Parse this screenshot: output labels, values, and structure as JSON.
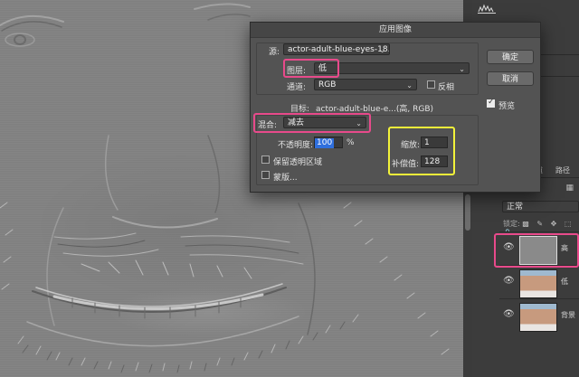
{
  "dialog": {
    "title": "应用图像",
    "source_label": "源:",
    "source_value": "actor-adult-blue-eyes-18...",
    "layer_label": "图层:",
    "layer_value": "低",
    "channel_label": "通道:",
    "channel_value": "RGB",
    "invert_label": "反相",
    "target_label": "目标:",
    "target_value": "actor-adult-blue-e...(高, RGB)",
    "blending_label": "混合:",
    "blending_value": "减去",
    "opacity_label": "不透明度:",
    "opacity_value": "100",
    "opacity_unit": "%",
    "preserve_transparency_label": "保留透明区域",
    "mask_label": "蒙版...",
    "scale_label": "缩放:",
    "scale_value": "1",
    "offset_label": "补偿值:",
    "offset_value": "128",
    "ok_label": "确定",
    "cancel_label": "取消",
    "preview_label": "预览",
    "preview_checked": true,
    "invert_checked": false,
    "preserve_checked": false,
    "mask_checked": false
  },
  "panel": {
    "tab_channels": "道",
    "tab_paths": "路径",
    "blend_mode": "正常",
    "lock_label": "锁定:"
  },
  "layers": [
    {
      "name": "高",
      "visible": true,
      "thumb": "gray-thumb-icon"
    },
    {
      "name": "低",
      "visible": true,
      "thumb": "portrait-thumb-icon"
    },
    {
      "name": "背景",
      "visible": true,
      "thumb": "portrait-thumb-icon"
    }
  ],
  "colors": {
    "highlight_pink": "#e84a8b",
    "highlight_yellow": "#f2f23a",
    "dialog_bg": "#535353",
    "panel_bg": "#3c3c3c",
    "selection_blue": "#2f6fdd"
  }
}
